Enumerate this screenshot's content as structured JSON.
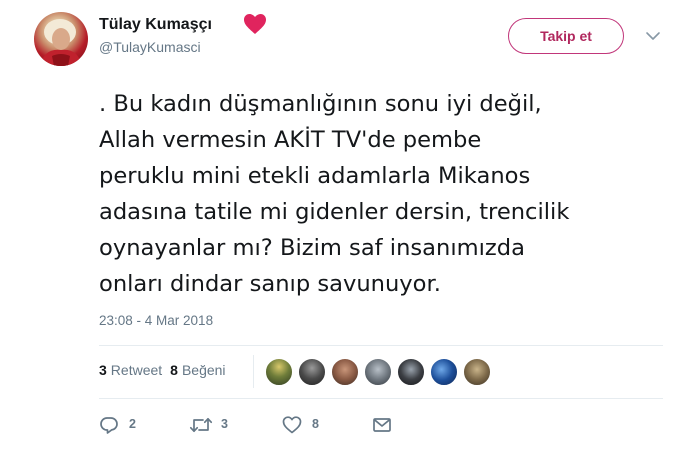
{
  "user": {
    "display_name": "Tülay Kumaşçı",
    "name_emoji": "red-heart",
    "handle": "@TulayKumasci"
  },
  "follow_button": {
    "label": "Takip et"
  },
  "tweet": {
    "lines": [
      ". Bu kadın düşmanlığının sonu iyi değil,",
      "Allah vermesin AKİT TV'de pembe",
      "peruklu mini etekli adamlarla Mikanos",
      "adasına tatile mi gidenler dersin, trencilik",
      "oynayanlar mı? Bizim saf insanımızda",
      "onları dindar sanıp savunuyor."
    ],
    "timestamp": "23:08 - 4 Mar 2018"
  },
  "stats": {
    "retweets": {
      "count": "3",
      "label": "Retweet"
    },
    "likes": {
      "count": "8",
      "label": "Beğeni"
    }
  },
  "liked_by_avatar_count": 7,
  "actions": {
    "reply": {
      "icon": "reply-icon",
      "count": "2"
    },
    "retweet": {
      "icon": "retweet-icon",
      "count": "3"
    },
    "like": {
      "icon": "heart-icon",
      "count": "8"
    },
    "message": {
      "icon": "envelope-icon"
    }
  },
  "colors": {
    "follow_accent": "#b1285e",
    "secondary_text": "#657786",
    "primary_text": "#14171a",
    "divider": "#e6ecf0",
    "heart_emoji": "#e0245e"
  }
}
